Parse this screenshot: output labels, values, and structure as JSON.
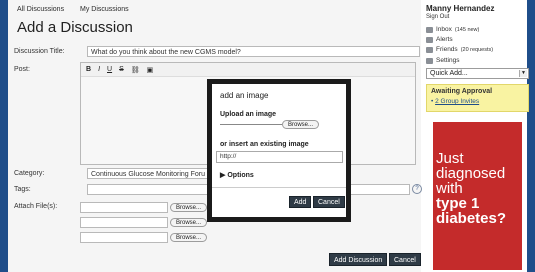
{
  "tabs": [
    "All Discussions",
    "My Discussions"
  ],
  "page_title": "Add a Discussion",
  "form": {
    "title_label": "Discussion Title:",
    "title_value": "What do you think about the new CGMS model?",
    "post_label": "Post:",
    "toolbar": [
      "B",
      "I",
      "U",
      "S",
      "link",
      "image"
    ],
    "category_label": "Category:",
    "category_value": "Continuous Glucose Monitoring Foru",
    "tags_label": "Tags:",
    "tags_value": "",
    "help_icon": "?",
    "attach_label": "Attach File(s):",
    "browse_label": "Browse...",
    "add_discussion_label": "Add Discussion",
    "cancel_label": "Cancel"
  },
  "sidebar": {
    "user_name": "Manny Hernandez",
    "sign_out": "Sign Out",
    "items": [
      {
        "label": "Inbox",
        "count": "(145 new)",
        "icon": "inbox-icon"
      },
      {
        "label": "Alerts",
        "count": "",
        "icon": "alerts-icon"
      },
      {
        "label": "Friends",
        "count": "(20 requests)",
        "icon": "friends-icon"
      },
      {
        "label": "Settings",
        "count": "",
        "icon": "settings-icon"
      }
    ],
    "quick_add": "Quick Add...",
    "approval_title": "Awaiting Approval",
    "approval_link": "2 Group Invites"
  },
  "ad": {
    "lines": [
      "Just",
      "diagnosed",
      "with",
      "type 1",
      "diabetes?"
    ]
  },
  "modal": {
    "title": "add an image",
    "upload_label": "Upload an image",
    "browse_label": "Browse...",
    "existing_label": "or insert an existing image",
    "url_value": "http://",
    "options_label": "Options",
    "add_label": "Add",
    "cancel_label": "Cancel"
  },
  "colors": {
    "background": "#1f4e8a",
    "ad_red": "#c42b2b",
    "approval_yellow": "#f9f3a2",
    "modal_frame": "#1b1b1b",
    "dark_button": "#2f3b46"
  }
}
